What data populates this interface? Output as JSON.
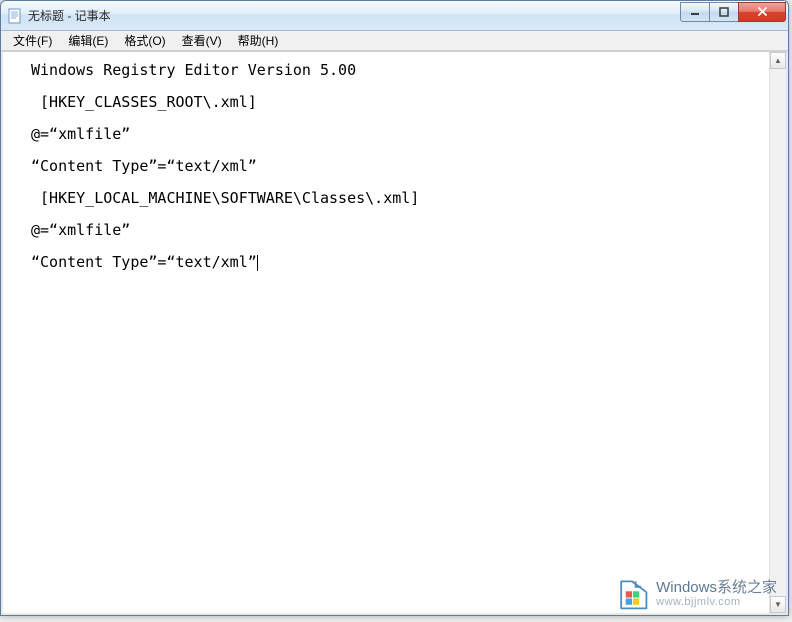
{
  "window": {
    "title": "无标题 - 记事本"
  },
  "menubar": {
    "items": [
      {
        "label": "文件(F)"
      },
      {
        "label": "编辑(E)"
      },
      {
        "label": "格式(O)"
      },
      {
        "label": "查看(V)"
      },
      {
        "label": "帮助(H)"
      }
    ]
  },
  "editor": {
    "lines": [
      "Windows Registry Editor Version 5.00",
      " [HKEY_CLASSES_ROOT\\.xml]",
      "@=“xmlfile”",
      "“Content Type”=“text/xml”",
      " [HKEY_LOCAL_MACHINE\\SOFTWARE\\Classes\\.xml]",
      "@=“xmlfile”",
      "“Content Type”=“text/xml”"
    ]
  },
  "scrollbar": {
    "up_glyph": "▲",
    "down_glyph": "▼"
  },
  "watermark": {
    "brand": "Windows",
    "suffix": "系统之家",
    "url": "www.bjjmlv.com"
  }
}
